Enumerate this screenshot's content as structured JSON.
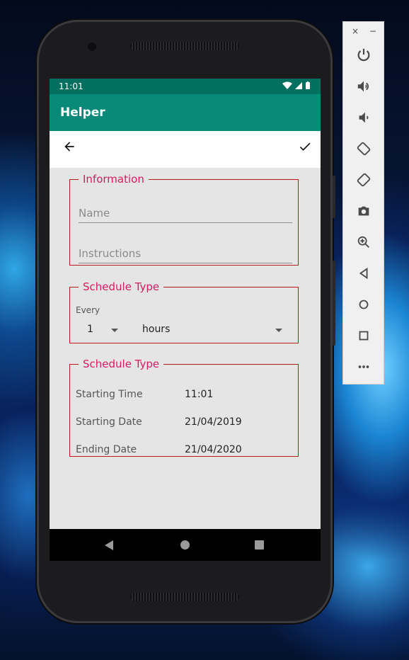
{
  "status_bar": {
    "time": "11:01"
  },
  "app_bar": {
    "title": "Helper"
  },
  "toolbar": {
    "back_icon": "arrow-left-icon",
    "confirm_icon": "check-icon"
  },
  "information": {
    "legend": "Information",
    "name_placeholder": "Name",
    "instructions_placeholder": "Instructions"
  },
  "schedule_every": {
    "legend": "Schedule Type",
    "every_label": "Every",
    "interval_value": "1",
    "unit_value": "hours"
  },
  "schedule_dates": {
    "legend": "Schedule Type",
    "rows": [
      {
        "label": "Starting Time",
        "value": "11:01"
      },
      {
        "label": "Starting Date",
        "value": "21/04/2019"
      },
      {
        "label": "Ending Date",
        "value": "21/04/2020"
      }
    ]
  },
  "colors": {
    "primary_dark": "#03705f",
    "primary": "#078a78",
    "accent": "#d81b60",
    "box_border": "#b71c1c"
  },
  "emulator_panel": {
    "close_label": "×",
    "minimize_label": "−",
    "buttons": [
      "power-icon",
      "volume-up-icon",
      "volume-down-icon",
      "rotate-left-icon",
      "rotate-right-icon",
      "camera-icon",
      "zoom-icon",
      "back-icon",
      "home-icon",
      "overview-icon",
      "more-icon"
    ]
  }
}
